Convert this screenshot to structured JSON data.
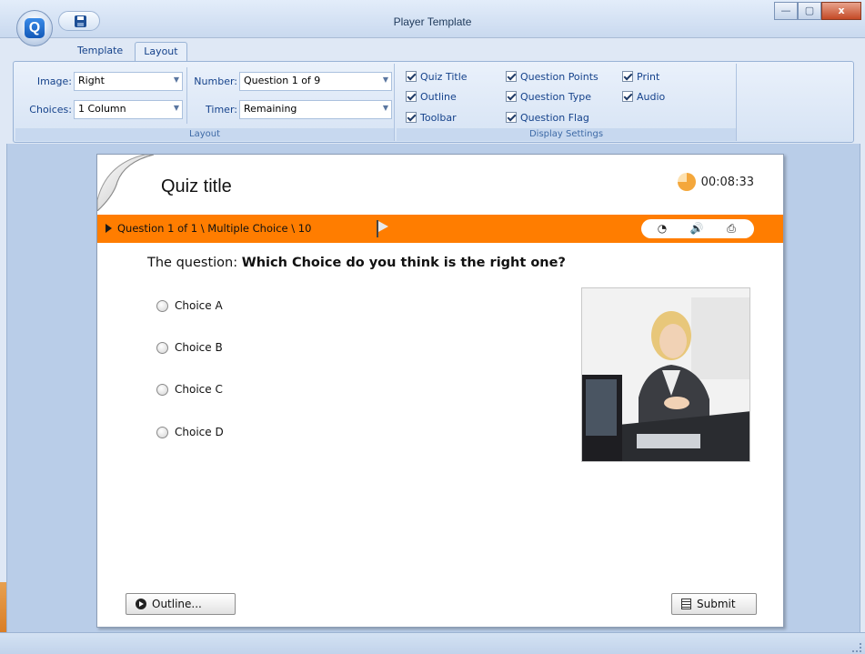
{
  "window": {
    "title": "Player Template",
    "min_label": "—",
    "max_label": "▢",
    "close_label": "x"
  },
  "app": {
    "logo_letter": "Q"
  },
  "ribbon": {
    "tabs": [
      {
        "label": "Template"
      },
      {
        "label": "Layout"
      }
    ],
    "layout_group": {
      "label": "Layout",
      "image_label": "Image:",
      "image_value": "Right",
      "choices_label": "Choices:",
      "choices_value": "1 Column",
      "number_label": "Number:",
      "number_value": "Question 1 of 9",
      "timer_label": "Timer:",
      "timer_value": "Remaining"
    },
    "display_group": {
      "label": "Display Settings",
      "checks": [
        {
          "label": "Quiz Title",
          "checked": true
        },
        {
          "label": "Outline",
          "checked": true
        },
        {
          "label": "Toolbar",
          "checked": true
        },
        {
          "label": "Question Points",
          "checked": true
        },
        {
          "label": "Question Type",
          "checked": true
        },
        {
          "label": "Question Flag",
          "checked": true
        },
        {
          "label": "Print",
          "checked": true
        },
        {
          "label": "Audio",
          "checked": true
        }
      ]
    }
  },
  "player": {
    "quiz_title": "Quiz title",
    "timer": "00:08:33",
    "question_bar": "Question 1 of 1 \\ Multiple Choice \\ 10",
    "question_prefix": "The question: ",
    "question_text": "Which Choice do you think is the right one?",
    "choices": [
      "Choice A",
      "Choice B",
      "Choice C",
      "Choice D"
    ],
    "outline_button": "Outline...",
    "submit_button": "Submit",
    "accent_color": "#ff7d00"
  }
}
